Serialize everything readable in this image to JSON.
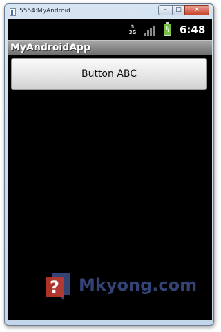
{
  "window": {
    "title": "5554:MyAndroid",
    "minimize_glyph": "–",
    "maximize_glyph": "□",
    "close_glyph": "×"
  },
  "status_bar": {
    "network_type": "3G",
    "network_arrows": "⇅",
    "signal_icon": "signal-strength-icon",
    "battery_icon": "battery-charging-icon",
    "time": "6:48"
  },
  "app": {
    "title": "MyAndroidApp",
    "button_label": "Button ABC"
  },
  "watermark": {
    "text": "Mkyong.com"
  },
  "colors": {
    "screen_background": "#000000",
    "title_bar": "#8a8a8a",
    "battery": "#78c044",
    "watermark": "#3c4f8a",
    "watermark_logo": "#c0392b"
  }
}
